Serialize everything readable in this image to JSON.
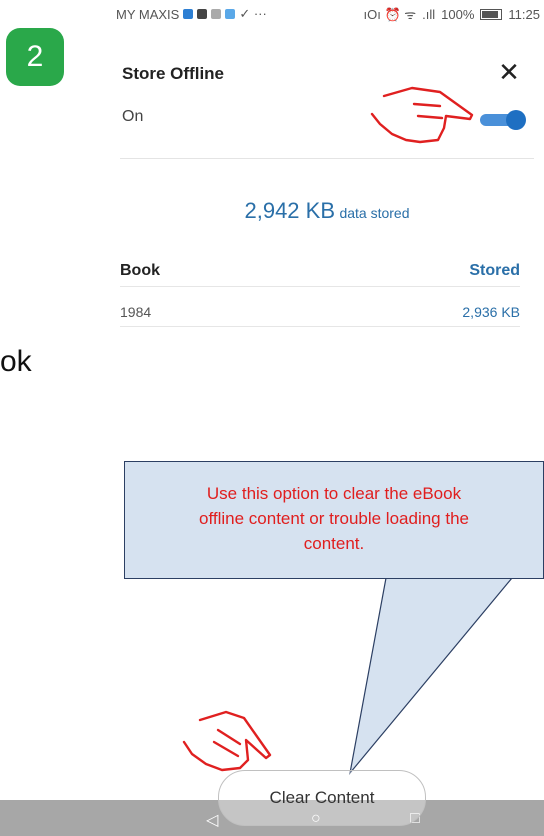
{
  "step": {
    "number": "2"
  },
  "side_text": "ok",
  "statusbar": {
    "carrier": "MY MAXIS",
    "extra": "✓ ···",
    "right_icons": "ıOı ⏰ ᯤ",
    "signal": ".ıll",
    "battery_pct": "100%",
    "time": "11:25"
  },
  "panel": {
    "title": "Store Offline",
    "close_symbol": "✕",
    "toggle_label": "On",
    "toggle_on": true,
    "stored_amount": "2,942 KB",
    "stored_suffix": "data stored"
  },
  "table": {
    "headers": {
      "book": "Book",
      "stored": "Stored"
    },
    "rows": [
      {
        "book": "1984",
        "stored": "2,936 KB"
      }
    ]
  },
  "callout": {
    "lines": [
      "Use this option to clear the eBook",
      "offline content or trouble loading the",
      "content."
    ]
  },
  "clear_button": {
    "label": "Clear Content"
  },
  "navbar": {
    "back": "◁",
    "home": "○",
    "recent": "□"
  },
  "colors": {
    "accent": "#2a6fa8",
    "toggle": "#1e6fc2",
    "step_badge": "#2aa84a",
    "callout_text": "#e01e1e",
    "callout_fill": "#d6e2f0",
    "pointer_red": "#e02020"
  }
}
